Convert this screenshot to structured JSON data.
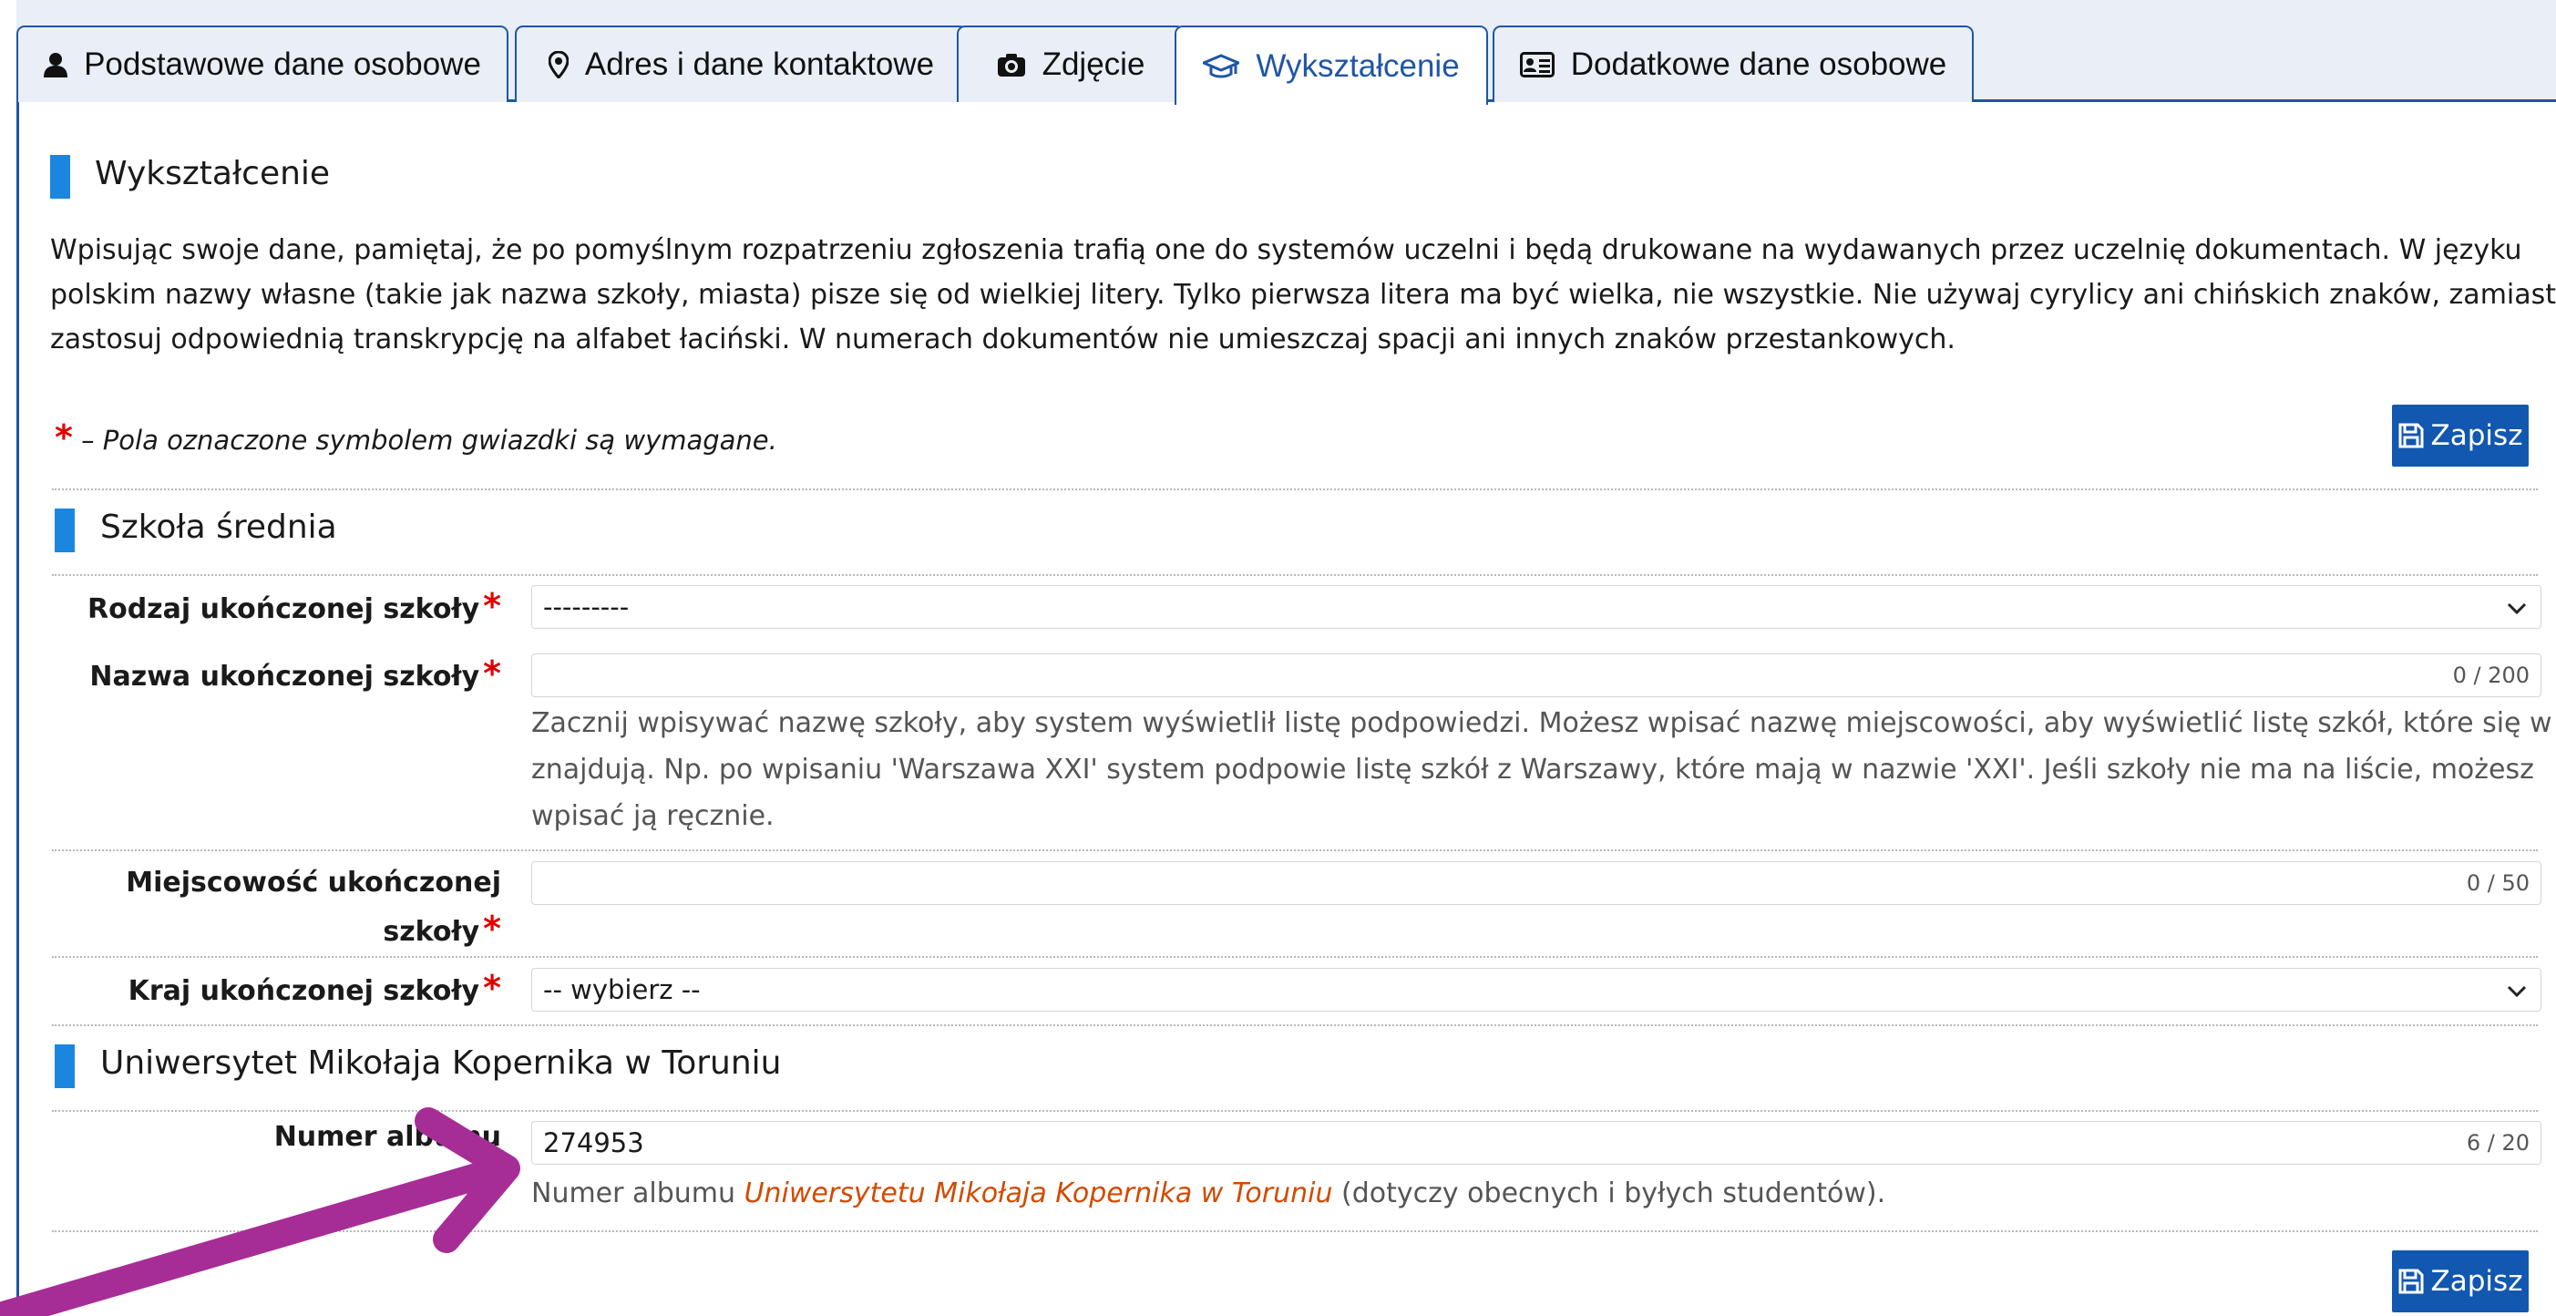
{
  "tabs": [
    {
      "label": "Podstawowe dane osobowe",
      "icon": "user-icon"
    },
    {
      "label": "Adres i dane kontaktowe",
      "icon": "map-marker-icon"
    },
    {
      "label": "Zdjęcie",
      "icon": "camera-icon"
    },
    {
      "label": "Wykształcenie",
      "icon": "graduation-cap-icon",
      "active": true
    },
    {
      "label": "Dodatkowe dane osobowe",
      "icon": "id-card-icon"
    }
  ],
  "section_title": "Wykształcenie",
  "intro_lines": [
    "Wpisując swoje dane, pamiętaj, że po pomyślnym rozpatrzeniu zgłoszenia trafią one do systemów uczelni i będą drukowane na wydawanych przez uczelnię dokumentach. W języku",
    "polskim nazwy własne (takie jak nazwa szkoły, miasta) pisze się od wielkiej litery. Tylko pierwsza litera ma być wielka, nie wszystkie. Nie używaj cyrylicy ani chińskich znaków, zamiast nich",
    "zastosuj odpowiednią transkrypcję na alfabet łaciński. W numerach dokumentów nie umieszczaj spacji ani innych znaków przestankowych."
  ],
  "required_note": {
    "star": "*",
    "text": "– Pola oznaczone symbolem gwiazdki są wymagane."
  },
  "save_label": "Zapisz",
  "high_school": {
    "title": "Szkoła średnia",
    "school_type": {
      "label": "Rodzaj ukończonej szkoły",
      "value": "---------"
    },
    "school_name": {
      "label": "Nazwa ukończonej szkoły",
      "value": "",
      "counter": "0 / 200",
      "help_lines": [
        "Zacznij wpisywać nazwę szkoły, aby system wyświetlił listę podpowiedzi. Możesz wpisać nazwę miejscowości, aby wyświetlić listę szkół, które się w niej",
        "znajdują. Np. po wpisaniu 'Warszawa XXI' system podpowie listę szkół z Warszawy, które mają w nazwie 'XXI'. Jeśli szkoły nie ma na liście, możesz",
        "wpisać ją ręcznie."
      ]
    },
    "school_city": {
      "label_line1": "Miejscowość ukończonej",
      "label_line2": "szkoły",
      "value": "",
      "counter": "0 / 50"
    },
    "school_country": {
      "label": "Kraj ukończonej szkoły",
      "value": "-- wybierz --"
    }
  },
  "university": {
    "title": "Uniwersytet Mikołaja Kopernika w Toruniu",
    "album": {
      "label": "Numer albumu",
      "value": "274953",
      "counter": "6 / 20",
      "help_prefix": "Numer albumu ",
      "help_link": "Uniwersytetu Mikołaja Kopernika w Toruniu",
      "help_suffix": " (dotyczy obecnych i byłych studentów)."
    }
  },
  "colors": {
    "accent": "#1f56a6",
    "section_bar": "#1a86e0",
    "required": "#e00000",
    "link": "#d24a00",
    "arrow": "#a72d96"
  }
}
